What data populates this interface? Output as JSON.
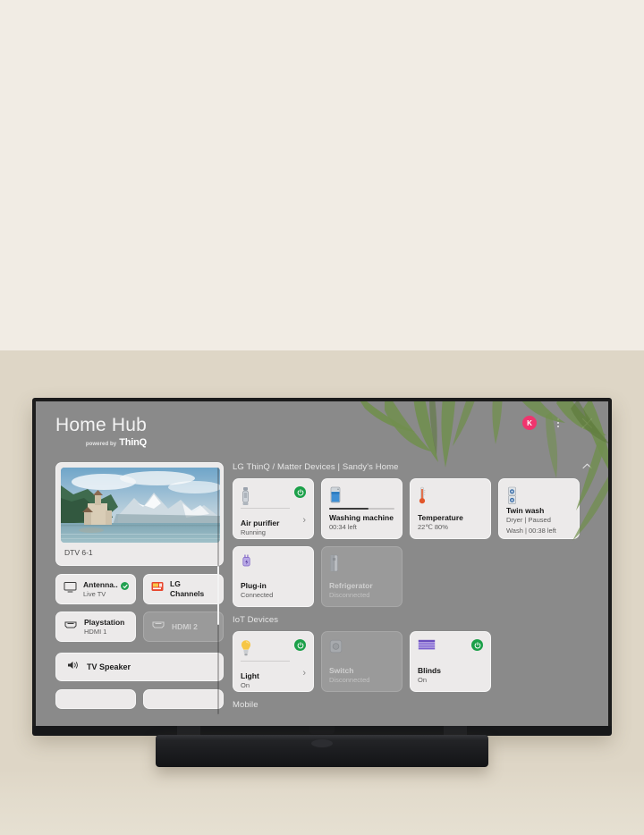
{
  "app": {
    "title": "Home Hub",
    "powered_by": "powered by",
    "brand": "ThinQ",
    "avatar_initial": "K",
    "kebab_icon": "more-vertical-icon",
    "close_icon": "close-icon"
  },
  "colors": {
    "accent_green": "#1ba049",
    "avatar_pink": "#f0356e",
    "screen_bg": "#8a8a8a",
    "card_bg": "#eceaea",
    "card_muted_bg": "#9a9a9a",
    "wall_upper": "#f1ece4",
    "wall_lower": "#ded6c6"
  },
  "sidebar": {
    "now_playing": {
      "label": "DTV 6-1",
      "thumb_icon": "landscape-photo"
    },
    "inputs": [
      {
        "name": "Antenna..",
        "sub": "Live TV",
        "icon": "tv-icon",
        "active": true,
        "checked": true
      },
      {
        "name": "LG Channels",
        "sub": "",
        "icon": "lg-channels-icon",
        "active": true,
        "checked": false
      },
      {
        "name": "Playstation",
        "sub": "HDMI 1",
        "icon": "hdmi-icon",
        "active": true,
        "checked": false
      },
      {
        "name": "HDMI 2",
        "sub": "",
        "icon": "hdmi-icon",
        "active": false,
        "checked": false
      }
    ],
    "speaker": {
      "label": "TV Speaker",
      "icon": "speaker-icon"
    }
  },
  "sections": [
    {
      "title": "LG ThinQ / Matter Devices | Sandy's Home",
      "collapse_icon": "chevron-up-icon",
      "collapsible": true,
      "cards": [
        {
          "name": "Air purifier",
          "subs": [
            "Running"
          ],
          "icon": "air-purifier-icon",
          "active": true,
          "power": true,
          "chevron": true,
          "divider": true
        },
        {
          "name": "Washing machine",
          "subs": [
            "00:34 left"
          ],
          "icon": "washing-machine-icon",
          "active": true,
          "power": false,
          "chevron": false,
          "progress": 60
        },
        {
          "name": "Temperature",
          "subs": [
            "22℃ 80%"
          ],
          "icon": "thermometer-icon",
          "active": true,
          "power": false,
          "chevron": false
        },
        {
          "name": "Twin wash",
          "subs": [
            "Dryer | Paused",
            "Wash | 00:38 left"
          ],
          "icon": "twin-wash-icon",
          "active": true,
          "power": false,
          "chevron": false
        },
        {
          "name": "Plug-in",
          "subs": [
            "Connected"
          ],
          "icon": "plug-icon",
          "active": true,
          "power": false,
          "chevron": false
        },
        {
          "name": "Refrigerator",
          "subs": [
            "Disconnected"
          ],
          "icon": "refrigerator-icon",
          "active": false,
          "power": false,
          "chevron": false
        }
      ]
    },
    {
      "title": "IoT Devices",
      "collapse_icon": "",
      "collapsible": false,
      "cards": [
        {
          "name": "Light",
          "subs": [
            "On"
          ],
          "icon": "light-bulb-icon",
          "active": true,
          "power": true,
          "chevron": true,
          "divider": true
        },
        {
          "name": "Switch",
          "subs": [
            "Disconnected"
          ],
          "icon": "switch-icon",
          "active": false,
          "power": false,
          "chevron": false
        },
        {
          "name": "Blinds",
          "subs": [
            "On"
          ],
          "icon": "blinds-icon",
          "active": true,
          "power": true,
          "chevron": false
        }
      ]
    },
    {
      "title": "Mobile",
      "collapse_icon": "",
      "collapsible": false,
      "cards": []
    }
  ]
}
